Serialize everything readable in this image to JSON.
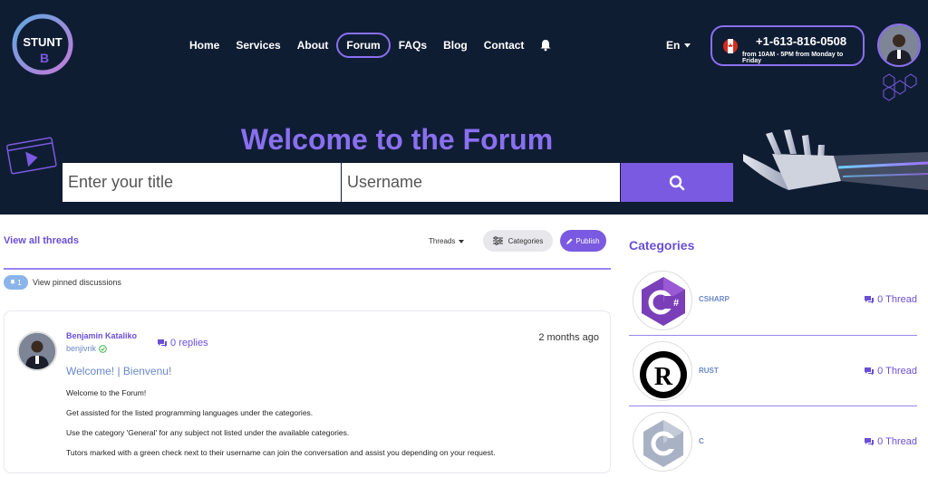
{
  "brand": {
    "logo_text": "STUNT",
    "logo_mark": "B"
  },
  "nav": {
    "items": [
      {
        "label": "Home"
      },
      {
        "label": "Services"
      },
      {
        "label": "About"
      },
      {
        "label": "Forum"
      },
      {
        "label": "FAQs"
      },
      {
        "label": "Blog"
      },
      {
        "label": "Contact"
      }
    ],
    "active": "Forum",
    "bell_icon": "bell-icon"
  },
  "language": {
    "selected": "En"
  },
  "contact": {
    "phone": "+1-613-816-0508",
    "hours": "from 10AM - 5PM from Monday to Friday",
    "flag_icon": "canada-flag-icon"
  },
  "hero": {
    "title": "Welcome to the Forum",
    "title_placeholder": "Enter your title",
    "username_placeholder": "Username",
    "search_icon": "search-icon"
  },
  "toolbar": {
    "view_all": "View all threads",
    "threads_dropdown": "Threads",
    "categories_button": "Categories",
    "publish_button": "Publish"
  },
  "pinned": {
    "count": "1",
    "label": "View pinned discussions"
  },
  "thread": {
    "author": "Benjamin Kataliko",
    "username": "benjivrik",
    "replies": "0 replies",
    "date": "2 months ago",
    "title": "Welcome! | Bienvenu!",
    "body": [
      "Welcome to the Forum!",
      "Get assisted for the listed programming languages under the categories.",
      "Use the category 'General' for any subject not listed under the available categories.",
      "Tutors marked with a green check next to their username can join the conversation and assist you depending on your request."
    ]
  },
  "categories": {
    "heading": "Categories",
    "items": [
      {
        "name": "CSHARP",
        "count": "0 Thread",
        "icon": "csharp-icon"
      },
      {
        "name": "RUST",
        "count": "0 Thread",
        "icon": "rust-icon"
      },
      {
        "name": "C",
        "count": "0 Thread",
        "icon": "c-language-icon"
      }
    ]
  },
  "colors": {
    "accent": "#7a5ae0",
    "header_bg": "#0f1d33",
    "link": "#6a88c8"
  }
}
